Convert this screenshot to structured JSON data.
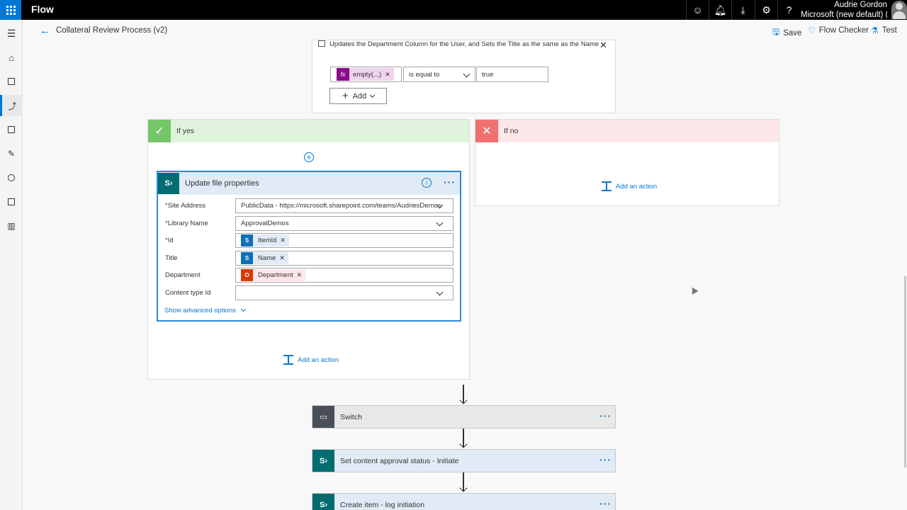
{
  "topbar": {
    "brand": "Flow",
    "user_name": "Audrie Gordon",
    "environment": "Microsoft (new default) (",
    "icons": [
      "smiley-icon",
      "bell-icon",
      "download-icon",
      "gear-icon",
      "help-icon"
    ]
  },
  "colors": {
    "accent": "#0078d4",
    "yes": "#74c769",
    "no": "#f07070",
    "sharepoint": "#036c70"
  },
  "command_bar": {
    "title": "Collateral Review Process (v2)",
    "save": "Save",
    "flow_checker": "Flow Checker",
    "test": "Test"
  },
  "condition": {
    "description": "Updates the Department Column for the User, and Sets the Title as the same as the Name",
    "left_token": "empty(...)",
    "operator": "is equal to",
    "right_value": "true",
    "add_label": "Add"
  },
  "if_yes": {
    "label": "If yes",
    "action": {
      "title": "Update file properties",
      "fields": [
        {
          "label": "Site Address",
          "required": "*",
          "value": "PublicData - https://microsoft.sharepoint.com/teams/AudriesDemos"
        },
        {
          "label": "Library Name",
          "required": "*",
          "value": "ApprovalDemos"
        },
        {
          "label": "Id",
          "required": "*",
          "token": "ItemId"
        },
        {
          "label": "Title",
          "required": "",
          "token": "Name"
        },
        {
          "label": "Department",
          "required": "",
          "token": "Department"
        },
        {
          "label": "Content type Id",
          "required": "",
          "value": ""
        }
      ],
      "advanced": "Show advanced options"
    },
    "add_action": "Add an action"
  },
  "if_no": {
    "label": "If no",
    "add_action": "Add an action"
  },
  "steps": [
    {
      "title": "Switch"
    },
    {
      "title": "Set content approval status - Initiate"
    },
    {
      "title": "Create item - log initiation"
    }
  ]
}
